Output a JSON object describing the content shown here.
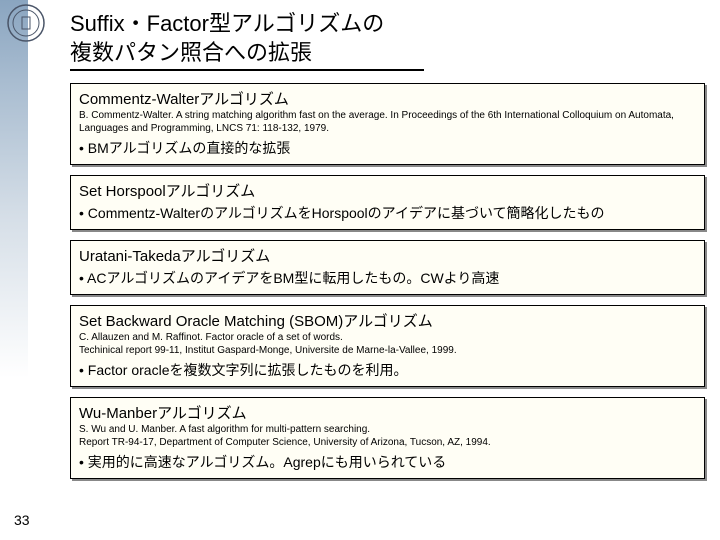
{
  "page_number": "33",
  "title_line1": "Suffix・Factor型アルゴリズムの",
  "title_line2": "複数パタン照合への拡張",
  "boxes": [
    {
      "title": "Commentz-Walterアルゴリズム",
      "cite": "B. Commentz-Walter. A string matching algorithm fast on the average. In Proceedings of the 6th International Colloquium on Automata, Languages and Programming, LNCS 71: 118-132, 1979.",
      "bullet": "• BMアルゴリズムの直接的な拡張"
    },
    {
      "title": "Set Horspoolアルゴリズム",
      "cite": "",
      "bullet": "• Commentz-WalterのアルゴリズムをHorspoolのアイデアに基づいて簡略化したもの"
    },
    {
      "title": "Uratani-Takedaアルゴリズム",
      "cite": "",
      "bullet": "• ACアルゴリズムのアイデアをBM型に転用したもの。CWより高速"
    },
    {
      "title": "Set Backward Oracle Matching (SBOM)アルゴリズム",
      "cite": "C. Allauzen and M. Raffinot. Factor oracle of a set of words.\nTechinical report 99-11, Institut Gaspard-Monge, Universite de Marne-la-Vallee, 1999.",
      "bullet": "• Factor oracleを複数文字列に拡張したものを利用。"
    },
    {
      "title": "Wu-Manberアルゴリズム",
      "cite": "S. Wu and U. Manber. A fast algorithm for multi-pattern searching.\nReport TR-94-17, Department of Computer Science, University of Arizona, Tucson, AZ, 1994.",
      "bullet": "• 実用的に高速なアルゴリズム。Agrepにも用いられている"
    }
  ]
}
